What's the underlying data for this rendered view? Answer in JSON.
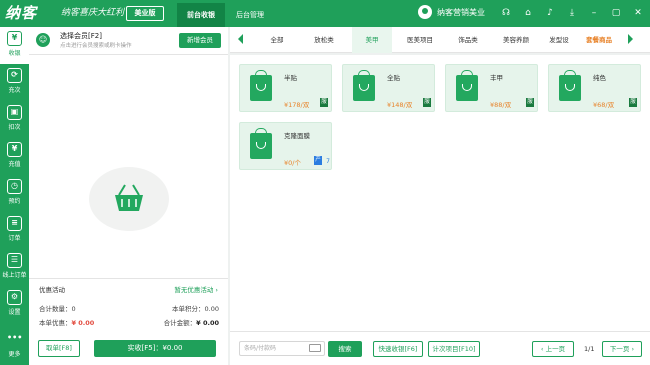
{
  "topbar": {
    "logo": "纳客",
    "slogan": "纳客喜庆大红利",
    "edition": "美业版",
    "tabs": [
      {
        "label": "前台收银"
      },
      {
        "label": "后台管理"
      }
    ],
    "user_name": "纳客营销美业",
    "icons": [
      "headset-icon",
      "home-icon",
      "bell-icon",
      "download-icon",
      "minimize-icon",
      "maximize-icon",
      "close-icon"
    ]
  },
  "sidebar": {
    "items": [
      {
        "label": "收银",
        "icon": "cashier-icon",
        "glyph": "¥"
      },
      {
        "label": "充次",
        "icon": "recharge-times-icon",
        "glyph": "⟳"
      },
      {
        "label": "扣次",
        "icon": "deduct-times-icon",
        "glyph": "▣"
      },
      {
        "label": "充值",
        "icon": "recharge-icon",
        "glyph": "¥"
      },
      {
        "label": "预约",
        "icon": "appointment-icon",
        "glyph": "◷"
      },
      {
        "label": "订单",
        "icon": "order-icon",
        "glyph": "≡"
      },
      {
        "label": "线上订单",
        "icon": "online-order-icon",
        "glyph": "☰"
      },
      {
        "label": "设置",
        "icon": "settings-icon",
        "glyph": "⚙"
      },
      {
        "label": "更多",
        "icon": "more-icon",
        "glyph": "•••"
      }
    ]
  },
  "member": {
    "title": "选择会员[F2]",
    "hint": "点击进行会员搜索或刷卡操作",
    "add_button": "新增会员"
  },
  "promo": {
    "label": "优惠活动",
    "value": "暂无优惠活动"
  },
  "summary": {
    "qty_label": "合计数量：",
    "qty_value": "0",
    "points_label": "本单积分：",
    "points_value": "0.00",
    "discount_label": "本单优惠：",
    "discount_value": "¥ 0.00",
    "total_label": "合计金额：",
    "total_value": "¥ 0.00"
  },
  "actions": {
    "cancel": "取单[F8]",
    "pay": "实收[F5]：¥0.00"
  },
  "categories": [
    {
      "label": "全部"
    },
    {
      "label": "放松类"
    },
    {
      "label": "美甲"
    },
    {
      "label": "医美项目"
    },
    {
      "label": "饰品类"
    },
    {
      "label": "美容养颜"
    },
    {
      "label": "发型设"
    },
    {
      "label": "套餐商品"
    }
  ],
  "products": [
    {
      "name": "半贴",
      "price": "¥178/双",
      "tag": "服"
    },
    {
      "name": "全贴",
      "price": "¥148/双",
      "tag": "服"
    },
    {
      "name": "丰甲",
      "price": "¥88/双",
      "tag": "服"
    },
    {
      "name": "纯色",
      "price": "¥68/双",
      "tag": "服"
    },
    {
      "name": "克隆面膜",
      "price": "¥0/个",
      "tag": "产",
      "extra": "7"
    }
  ],
  "bottom": {
    "search_placeholder": "条码/付款码",
    "search_button": "搜索",
    "quick_cash": "快速收银[F6]",
    "count_item": "计次项目[F10]",
    "prev": "上一页",
    "page": "1/1",
    "next": "下一页"
  },
  "colors": {
    "primary": "#1fa05a",
    "accent": "#e8832a",
    "danger": "#e24b3f"
  }
}
